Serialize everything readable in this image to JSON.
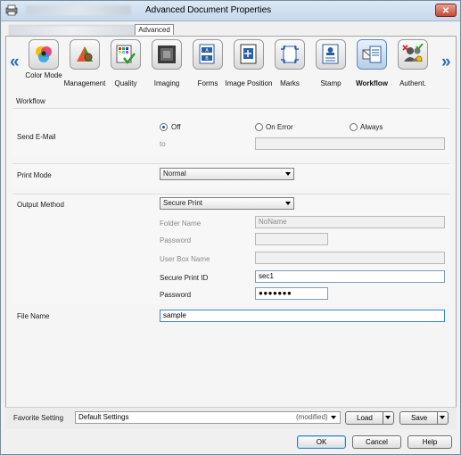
{
  "window": {
    "title": "Advanced Document Properties",
    "close_label": "✕"
  },
  "tabs": {
    "advanced_label": "Advanced"
  },
  "nav": {
    "left_arrow": "«",
    "right_arrow": "»"
  },
  "categories": [
    {
      "label": "Color Mode",
      "icon": "color-mode-icon"
    },
    {
      "label": "Management",
      "icon": "management-icon"
    },
    {
      "label": "Quality",
      "icon": "quality-icon"
    },
    {
      "label": "Imaging",
      "icon": "imaging-icon"
    },
    {
      "label": "Forms",
      "icon": "forms-icon"
    },
    {
      "label": "Image Position",
      "icon": "image-position-icon"
    },
    {
      "label": "Marks",
      "icon": "marks-icon"
    },
    {
      "label": "Stamp",
      "icon": "stamp-icon"
    },
    {
      "label": "Workflow",
      "icon": "workflow-icon",
      "active": true
    },
    {
      "label": "Authent.",
      "icon": "authentication-icon"
    }
  ],
  "workflow": {
    "section_title": "Workflow",
    "send_email": {
      "label": "Send E-Mail",
      "options": [
        "Off",
        "On Error",
        "Always"
      ],
      "selected": "Off",
      "to_label": "to",
      "to_value": ""
    },
    "print_mode": {
      "label": "Print Mode",
      "value": "Normal"
    },
    "output_method": {
      "label": "Output Method",
      "value": "Secure Print",
      "folder_name_label": "Folder Name",
      "folder_name_value": "NoName",
      "password_label": "Password",
      "user_box_name_label": "User Box Name",
      "secure_print_id_label": "Secure Print ID",
      "secure_print_id_value": "sec1",
      "secure_password_label": "Password",
      "secure_password_value": "●●●●●●●"
    },
    "file_name": {
      "label": "File Name",
      "value": "sample"
    }
  },
  "footer": {
    "favorite_label": "Favorite Setting",
    "favorite_value": "Default Settings",
    "modified_text": "(modified)",
    "load_label": "Load",
    "save_label": "Save",
    "ok_label": "OK",
    "cancel_label": "Cancel",
    "help_label": "Help"
  }
}
